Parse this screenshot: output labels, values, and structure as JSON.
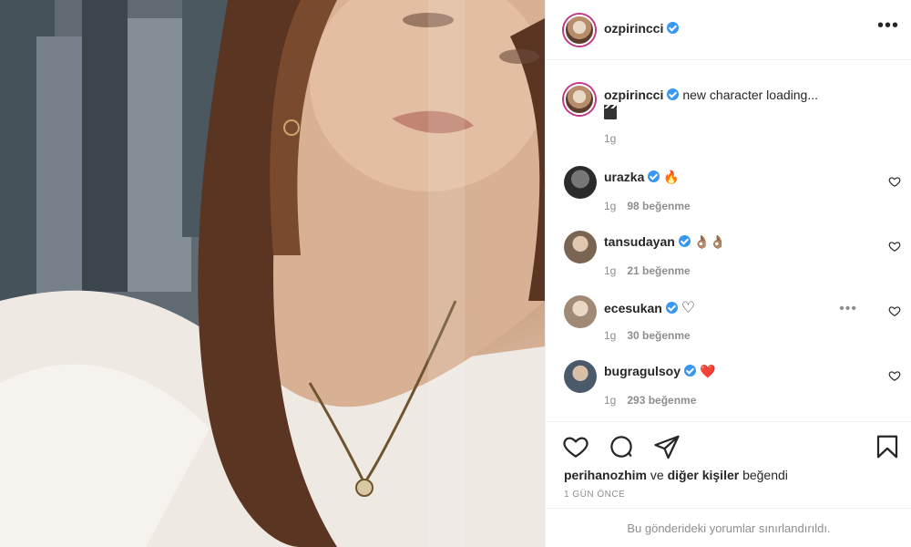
{
  "post": {
    "author": "ozpirincci",
    "caption": "new character loading...",
    "caption_time": "1g",
    "liked_by_user": "perihanozhim",
    "liked_by_connector": "ve",
    "liked_by_others": "diğer kişiler",
    "liked_by_suffix": "beğendi",
    "posted_ago": "1 GÜN ÖNCE",
    "comments_limited_notice": "Bu gönderideki yorumlar sınırlandırıldı."
  },
  "comments": [
    {
      "username": "urazka",
      "emoji": "🔥",
      "time": "1g",
      "likes": "98 beğenme",
      "avatar_color": "#2b2b2b"
    },
    {
      "username": "tansudayan",
      "emoji": "👌🏽👌🏽",
      "time": "1g",
      "likes": "21 beğenme",
      "avatar_color": "#7a6452"
    },
    {
      "username": "ecesukan",
      "emoji": "♡",
      "time": "1g",
      "likes": "30 beğenme",
      "avatar_color": "#a08a76"
    },
    {
      "username": "bugragulsoy",
      "emoji": "❤️",
      "time": "1g",
      "likes": "293 beğenme",
      "avatar_color": "#4a5a6a"
    }
  ],
  "icons": {
    "verified": "verified-badge-icon",
    "more": "more-horizontal-icon",
    "like": "heart-icon",
    "comment": "comment-bubble-icon",
    "share": "paper-plane-icon",
    "save": "bookmark-icon"
  },
  "colors": {
    "accent": "#3897f0",
    "story_ring": "#c13584",
    "muted_text": "#8e8e8e",
    "heart_red": "#ed4956"
  }
}
